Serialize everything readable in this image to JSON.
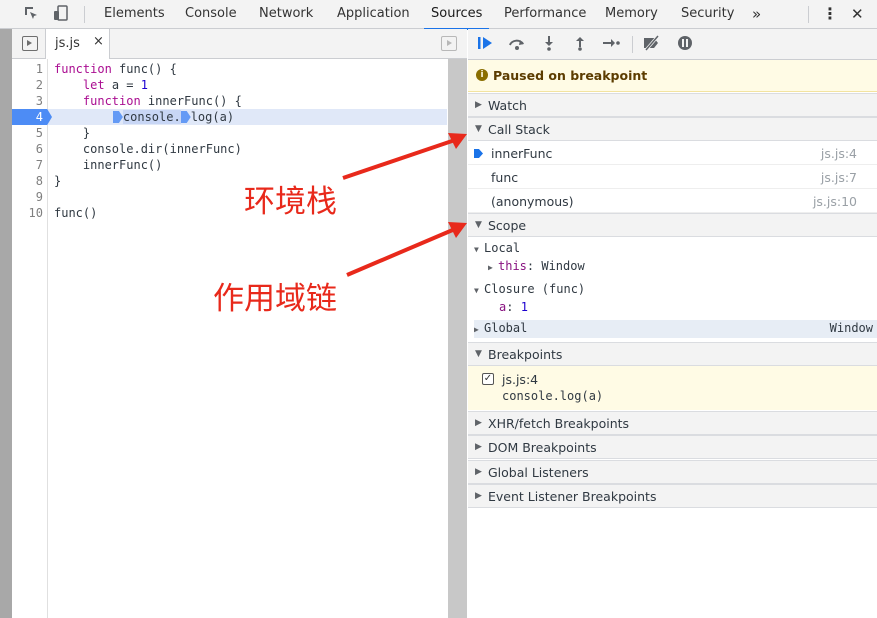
{
  "devtools_tabs": [
    "Elements",
    "Console",
    "Network",
    "Application",
    "Sources",
    "Performance",
    "Memory",
    "Security"
  ],
  "active_tab": "Sources",
  "more_tabs": "»",
  "more_menu": "⋮",
  "close_label": "✕",
  "file_tab": {
    "name": "js.js",
    "close": "×"
  },
  "code_lines": [
    {
      "n": "1",
      "t": "function func() {"
    },
    {
      "n": "2",
      "t": "    let a = 1"
    },
    {
      "n": "3",
      "t": "    function innerFunc() {"
    },
    {
      "n": "4",
      "t": "console.log(a)"
    },
    {
      "n": "5",
      "t": "    }"
    },
    {
      "n": "6",
      "t": "    console.dir(innerFunc)"
    },
    {
      "n": "7",
      "t": "    innerFunc()"
    },
    {
      "n": "8",
      "t": "}"
    },
    {
      "n": "9",
      "t": ""
    },
    {
      "n": "10",
      "t": "func()"
    }
  ],
  "paused_text": "Paused on breakpoint",
  "sections": {
    "watch": "Watch",
    "call_stack": "Call Stack",
    "scope": "Scope",
    "breakpoints": "Breakpoints",
    "xhr": "XHR/fetch Breakpoints",
    "dom": "DOM Breakpoints",
    "global_listeners": "Global Listeners",
    "event_listeners": "Event Listener Breakpoints"
  },
  "call_stack": [
    {
      "name": "innerFunc",
      "loc": "js.js:4",
      "current": true
    },
    {
      "name": "func",
      "loc": "js.js:7"
    },
    {
      "name": "(anonymous)",
      "loc": "js.js:10"
    }
  ],
  "scope": {
    "local": "Local",
    "this_key": "this",
    "this_val": "Window",
    "closure": "Closure (func)",
    "a_key": "a",
    "a_val": "1",
    "global": "Global",
    "global_val": "Window"
  },
  "breakpoint": {
    "file": "js.js:4",
    "code": "console.log(a)"
  },
  "annotations": {
    "env_stack": "环境栈",
    "scope_chain": "作用域链"
  },
  "colors": {
    "accent": "#1a73e8",
    "annotation": "#e8291b",
    "paused_bg": "#fffbe5"
  }
}
